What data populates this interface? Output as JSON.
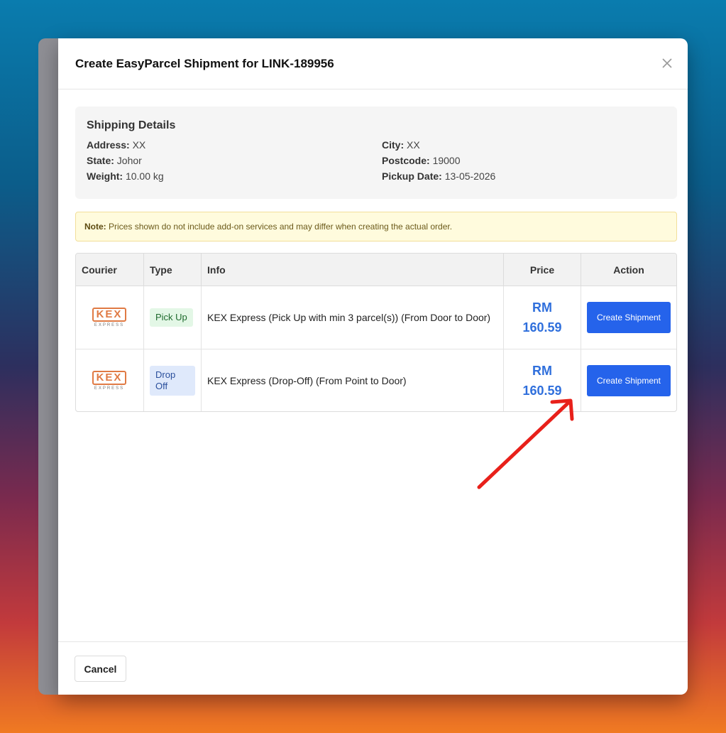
{
  "modal": {
    "title": "Create EasyParcel Shipment for LINK-189956",
    "close_icon": "close-icon"
  },
  "details": {
    "heading": "Shipping Details",
    "address_label": "Address:",
    "address": "XX",
    "city_label": "City:",
    "city": "XX",
    "state_label": "State:",
    "state": "Johor",
    "postcode_label": "Postcode:",
    "postcode": "19000",
    "weight_label": "Weight:",
    "weight": "10.00 kg",
    "pickup_label": "Pickup Date:",
    "pickup": "13-05-2026"
  },
  "note": {
    "label": "Note:",
    "text": "Prices shown do not include add-on services and may differ when creating the actual order."
  },
  "table": {
    "headers": [
      "Courier",
      "Type",
      "Info",
      "Price",
      "Action"
    ],
    "rows": [
      {
        "logo_text": "KEX",
        "logo_sub": "EXPRESS",
        "type": "Pick Up",
        "info": "KEX Express (Pick Up with min 3 parcel(s)) (From Door to Door)",
        "price_currency": "RM",
        "price_value": "160.59",
        "action": "Create Shipment"
      },
      {
        "logo_text": "KEX",
        "logo_sub": "EXPRESS",
        "type": "Drop Off",
        "info": "KEX Express (Drop-Off) (From Point to Door)",
        "price_currency": "RM",
        "price_value": "160.59",
        "action": "Create Shipment"
      }
    ]
  },
  "footer": {
    "cancel_label": "Cancel"
  },
  "colors": {
    "accent": "#2563eb",
    "price": "#2f6fdc",
    "annotation_arrow": "#e8201a"
  }
}
